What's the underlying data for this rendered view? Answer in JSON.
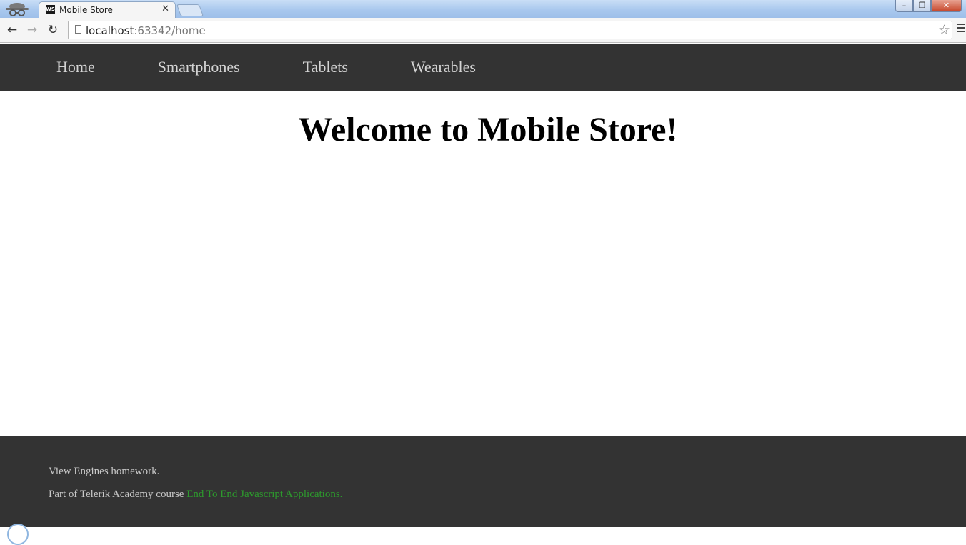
{
  "browser": {
    "tab": {
      "favicon_text": "WS",
      "title": "Mobile Store",
      "close_glyph": "✕"
    },
    "address_bar": {
      "host": "localhost",
      "path": ":63342/home"
    },
    "icons": {
      "back": "arrow-left-icon",
      "forward": "arrow-right-icon",
      "reload": "reload-icon",
      "bookmark": "star-icon",
      "menu": "hamburger-menu-icon",
      "incognito": "incognito-icon"
    },
    "window_controls": {
      "minimize_glyph": "–",
      "maximize_glyph": "❐",
      "close_glyph": "✕"
    }
  },
  "site": {
    "nav": {
      "items": [
        {
          "label": "Home"
        },
        {
          "label": "Smartphones"
        },
        {
          "label": "Tablets"
        },
        {
          "label": "Wearables"
        }
      ]
    },
    "main": {
      "title": "Welcome to Mobile Store!"
    },
    "footer": {
      "line1": "View Engines homework.",
      "line2_prefix": "Part of Telerik Academy course ",
      "line2_link": "End To End Javascript Applications."
    }
  },
  "colors": {
    "nav_background": "#333333",
    "footer_background": "#333333",
    "nav_link": "#d4d4d4",
    "footer_link": "#2d9a2d"
  }
}
